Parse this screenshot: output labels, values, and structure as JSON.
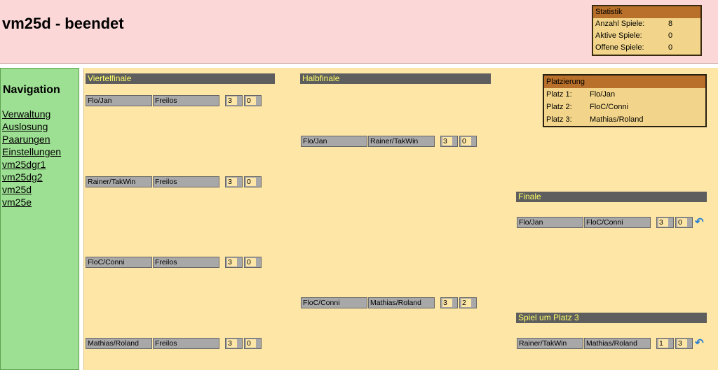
{
  "header": {
    "title": "vm25d - beendet"
  },
  "statistik": {
    "title": "Statistik",
    "rows": [
      {
        "label": "Anzahl Spiele:",
        "value": "8"
      },
      {
        "label": "Aktive Spiele:",
        "value": "0"
      },
      {
        "label": "Offene Spiele:",
        "value": "0"
      }
    ]
  },
  "nav": {
    "title": "Navigation",
    "items": [
      "Verwaltung",
      "Auslosung",
      "Paarungen",
      "Einstellungen",
      "vm25dgr1",
      "vm25dg2",
      "vm25d",
      "vm25e"
    ]
  },
  "sections": {
    "viertelfinale": "Viertelfinale",
    "halbfinale": "Halbfinale",
    "finale": "Finale",
    "platz3": "Spiel um Platz 3"
  },
  "viertelfinale": [
    {
      "team1": "Flo/Jan",
      "team2": "Freilos",
      "score1": "3",
      "score2": "0"
    },
    {
      "team1": "Rainer/TakWin",
      "team2": "Freilos",
      "score1": "3",
      "score2": "0"
    },
    {
      "team1": "FloC/Conni",
      "team2": "Freilos",
      "score1": "3",
      "score2": "0"
    },
    {
      "team1": "Mathias/Roland",
      "team2": "Freilos",
      "score1": "3",
      "score2": "0"
    }
  ],
  "halbfinale": [
    {
      "team1": "Flo/Jan",
      "team2": "Rainer/TakWin",
      "score1": "3",
      "score2": "0"
    },
    {
      "team1": "FloC/Conni",
      "team2": "Mathias/Roland",
      "score1": "3",
      "score2": "2"
    }
  ],
  "finale": {
    "team1": "Flo/Jan",
    "team2": "FloC/Conni",
    "score1": "3",
    "score2": "0"
  },
  "platz3": {
    "team1": "Rainer/TakWin",
    "team2": "Mathias/Roland",
    "score1": "1",
    "score2": "3"
  },
  "platzierung": {
    "title": "Platzierung",
    "rows": [
      {
        "label": "Platz 1:",
        "name": "Flo/Jan"
      },
      {
        "label": "Platz 2:",
        "name": "FloC/Conni"
      },
      {
        "label": "Platz 3:",
        "name": "Mathias/Roland"
      }
    ]
  },
  "icons": {
    "undo": "undo-icon"
  }
}
